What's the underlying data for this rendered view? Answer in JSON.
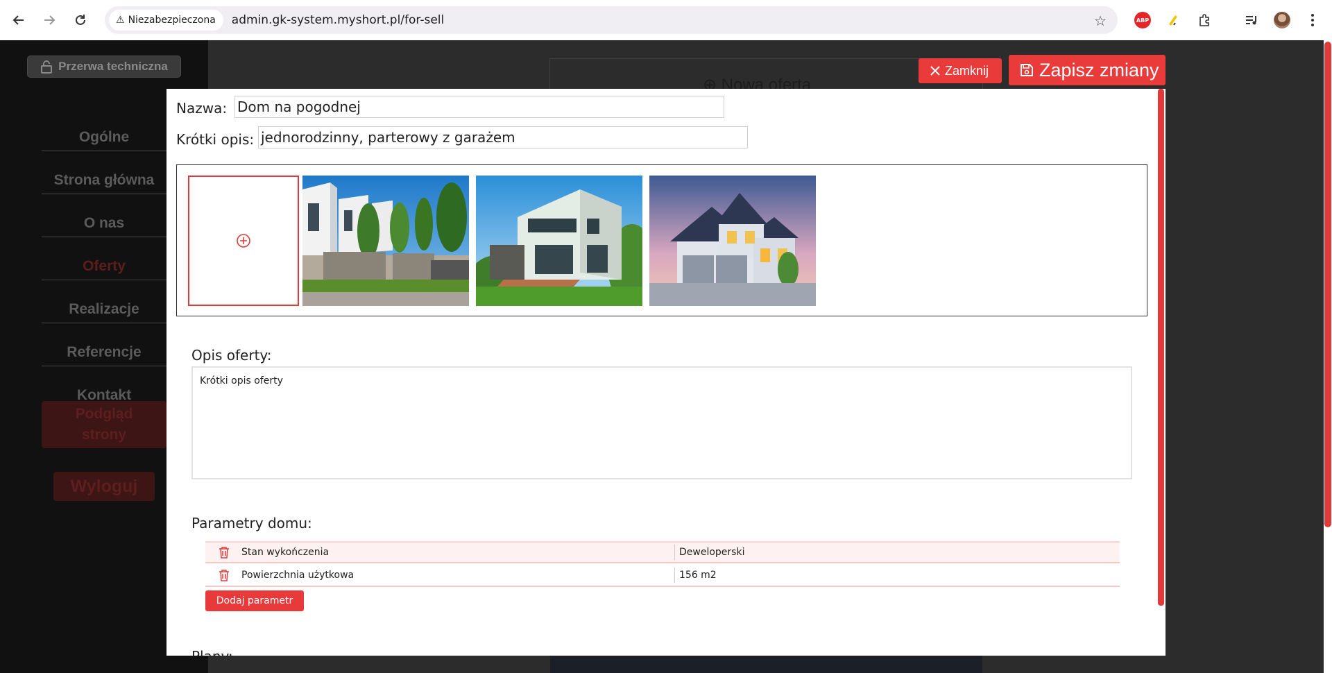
{
  "browser": {
    "security_label": "Niezabezpieczona",
    "url": "admin.gk-system.myshort.pl/for-sell",
    "abp_label": "ABP"
  },
  "sidebar": {
    "maintenance_label": "Przerwa techniczna",
    "items": [
      {
        "label": "Ogólne"
      },
      {
        "label": "Strona główna"
      },
      {
        "label": "O nas"
      },
      {
        "label": "Oferty"
      },
      {
        "label": "Realizacje"
      },
      {
        "label": "Referencje"
      },
      {
        "label": "Kontakt"
      }
    ],
    "active_item": "Oferty",
    "preview_label_line1": "Podgląd",
    "preview_label_line2": "strony",
    "logout_label": "Wyloguj"
  },
  "background": {
    "new_offer_label": "Nowa oferta"
  },
  "modal": {
    "close_label": "Zamknij",
    "save_label": "Zapisz zmiany",
    "name_label": "Nazwa:",
    "name_value": "Dom na pogodnej",
    "short_desc_label": "Krótki opis:",
    "short_desc_value": "jednorodzinny, parterowy z garażem",
    "photos": [
      {
        "alt": "modern-townhouses-photo"
      },
      {
        "alt": "modern-villa-with-terrace-photo"
      },
      {
        "alt": "family-house-with-garage-photo"
      }
    ],
    "description_label": "Opis oferty:",
    "description_value": "Krótki opis oferty",
    "params_label": "Parametry domu:",
    "params": [
      {
        "name": "Stan wykończenia",
        "value": "Deweloperski"
      },
      {
        "name": "Powierzchnia użytkowa",
        "value": "156 m2"
      }
    ],
    "add_param_label": "Dodaj parametr",
    "plans_label": "Plany:"
  },
  "colors": {
    "accent": "#ea3b3b",
    "sidebar_bg": "#111111",
    "overlay_bg": "#2c2c2c"
  }
}
